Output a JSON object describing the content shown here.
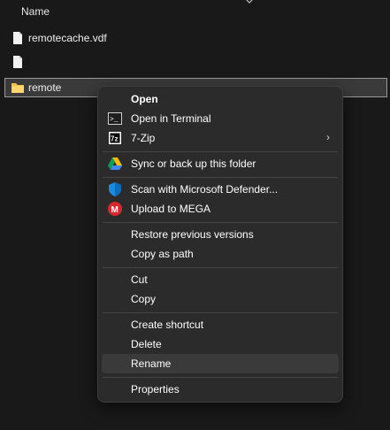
{
  "header": {
    "column_name": "Name"
  },
  "files": [
    {
      "name": "remotecache.vdf",
      "icon": "file-icon"
    },
    {
      "name": "",
      "icon": "file-icon"
    },
    {
      "name": "remote",
      "icon": "folder-icon"
    }
  ],
  "menu": {
    "open": "Open",
    "open_terminal": "Open in Terminal",
    "zip": "7-Zip",
    "sync": "Sync or back up this folder",
    "defender": "Scan with Microsoft Defender...",
    "mega": "Upload to MEGA",
    "restore": "Restore previous versions",
    "copy_path": "Copy as path",
    "cut": "Cut",
    "copy": "Copy",
    "create_shortcut": "Create shortcut",
    "delete": "Delete",
    "rename": "Rename",
    "properties": "Properties",
    "submenu_arrow": "›",
    "zip_icon_text": "7z",
    "mega_icon_text": "M",
    "terminal_icon_text": ">_",
    "colors": {
      "menu_bg": "#2b2b2b",
      "hover_bg": "#3a3a3a",
      "folder": "#f5c04a",
      "mega": "#d9272e",
      "defender": "#1a8be0"
    }
  }
}
